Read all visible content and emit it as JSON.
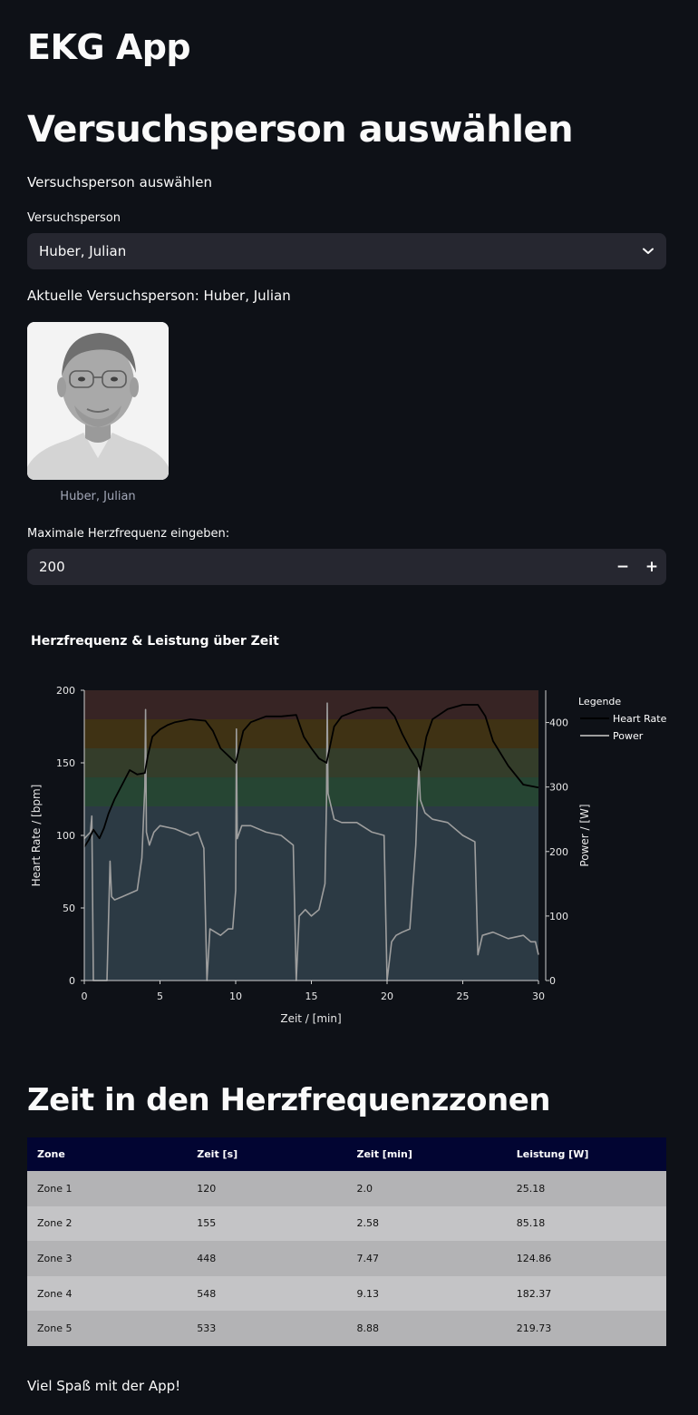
{
  "app": {
    "title": "EKG App"
  },
  "section": {
    "title": "Versuchsperson auswählen",
    "subtitle": "Versuchsperson auswählen"
  },
  "select": {
    "label": "Versuchsperson",
    "value": "Huber, Julian",
    "icon": "chevron-down-icon"
  },
  "current_person": "Aktuelle Versuchsperson: Huber, Julian",
  "photo": {
    "caption": "Huber, Julian"
  },
  "max_hr": {
    "label": "Maximale Herzfrequenz eingeben:",
    "value": "200",
    "minus": "−",
    "plus": "+"
  },
  "chart_data": {
    "type": "line",
    "title": "Herzfrequenz & Leistung über Zeit",
    "xlabel": "Zeit / [min]",
    "ylabel": "Heart Rate / [bpm]",
    "y2label": "Power / [W]",
    "xlim": [
      0,
      30
    ],
    "ylim": [
      0,
      200
    ],
    "y2lim": [
      0,
      450
    ],
    "xticks": [
      0,
      5,
      10,
      15,
      20,
      25,
      30
    ],
    "yticks": [
      0,
      50,
      100,
      150,
      200
    ],
    "y2ticks": [
      0,
      100,
      200,
      300,
      400
    ],
    "legend_title": "Legende",
    "legend_position": "right",
    "zones": [
      {
        "from": 0,
        "to": 120,
        "color": "#2c3a44"
      },
      {
        "from": 120,
        "to": 140,
        "color": "#264533"
      },
      {
        "from": 140,
        "to": 160,
        "color": "#343d2a"
      },
      {
        "from": 160,
        "to": 180,
        "color": "#3f3214"
      },
      {
        "from": 180,
        "to": 200,
        "color": "#372424"
      }
    ],
    "series": [
      {
        "name": "Heart Rate",
        "axis": "left",
        "color": "#000000",
        "x": [
          0,
          0.3,
          0.6,
          1,
          1.3,
          1.6,
          2,
          2.5,
          3,
          3.5,
          4,
          4.2,
          4.5,
          5,
          5.5,
          6,
          7,
          8,
          8.5,
          9,
          9.5,
          10,
          10.5,
          11,
          12,
          13,
          14,
          14.5,
          15,
          15.5,
          16,
          16.5,
          17,
          18,
          19,
          20,
          20.5,
          21,
          21.5,
          22,
          22.2,
          22.6,
          23,
          24,
          25,
          26,
          26.5,
          27,
          28,
          29,
          30
        ],
        "values": [
          92,
          97,
          104,
          98,
          105,
          115,
          125,
          135,
          145,
          142,
          143,
          155,
          168,
          173,
          176,
          178,
          180,
          179,
          172,
          160,
          155,
          150,
          172,
          178,
          182,
          182,
          183,
          168,
          160,
          153,
          150,
          175,
          182,
          186,
          188,
          188,
          182,
          170,
          160,
          152,
          145,
          168,
          180,
          187,
          190,
          190,
          182,
          165,
          148,
          135,
          133
        ]
      },
      {
        "name": "Power",
        "axis": "right",
        "color": "#9e9e9e",
        "x": [
          0,
          0.4,
          0.5,
          0.6,
          0.7,
          1.5,
          1.7,
          1.8,
          2,
          2.5,
          3,
          3.5,
          3.8,
          4,
          4.05,
          4.1,
          4.3,
          4.6,
          5,
          6,
          7,
          7.5,
          7.9,
          8.1,
          8.3,
          9,
          9.5,
          9.8,
          10,
          10.05,
          10.1,
          10.4,
          11,
          12,
          13,
          13.8,
          14,
          14.2,
          14.6,
          15,
          15.5,
          15.9,
          16,
          16.05,
          16.1,
          16.5,
          17,
          18,
          19,
          19.8,
          20,
          20.3,
          20.6,
          21,
          21.5,
          21.9,
          22,
          22.1,
          22.2,
          22.5,
          23,
          24,
          25,
          25.8,
          26,
          26.3,
          27,
          28,
          29,
          29.5,
          29.8,
          30
        ],
        "values": [
          220,
          230,
          255,
          0,
          0,
          0,
          185,
          130,
          125,
          130,
          135,
          140,
          190,
          300,
          420,
          230,
          210,
          230,
          240,
          235,
          225,
          230,
          205,
          0,
          80,
          70,
          80,
          80,
          140,
          390,
          220,
          240,
          240,
          230,
          225,
          210,
          0,
          100,
          110,
          100,
          110,
          150,
          280,
          430,
          290,
          250,
          245,
          245,
          230,
          225,
          0,
          60,
          70,
          75,
          80,
          210,
          280,
          330,
          280,
          260,
          250,
          245,
          225,
          215,
          40,
          70,
          75,
          65,
          70,
          60,
          60,
          40
        ]
      }
    ]
  },
  "zones_table": {
    "title": "Zeit in den Herzfrequenzzonen",
    "headers": [
      "Zone",
      "Zeit [s]",
      "Zeit [min]",
      "Leistung [W]"
    ],
    "rows": [
      [
        "Zone 1",
        "120",
        "2.0",
        "25.18"
      ],
      [
        "Zone 2",
        "155",
        "2.58",
        "85.18"
      ],
      [
        "Zone 3",
        "448",
        "7.47",
        "124.86"
      ],
      [
        "Zone 4",
        "548",
        "9.13",
        "182.37"
      ],
      [
        "Zone 5",
        "533",
        "8.88",
        "219.73"
      ]
    ]
  },
  "footer": "Viel Spaß mit der App!"
}
